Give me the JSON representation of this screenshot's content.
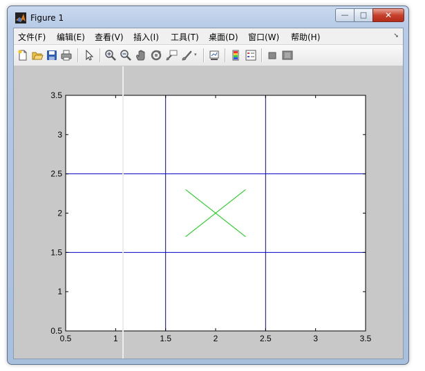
{
  "window": {
    "title": "Figure 1",
    "close_label": "✕",
    "min_label": "—",
    "max_label": "□"
  },
  "menu": {
    "items": [
      "文件(F)",
      "编辑(E)",
      "查看(V)",
      "插入(I)",
      "工具(T)",
      "桌面(D)",
      "窗口(W)",
      "帮助(H)"
    ],
    "overflow": "➘"
  },
  "toolbar": {
    "icons": [
      "new-figure-icon",
      "open-file-icon",
      "save-icon",
      "print-icon",
      "select-arrow-icon",
      "zoom-in-icon",
      "zoom-out-icon",
      "pan-hand-icon",
      "rotate-3d-icon",
      "data-cursor-icon",
      "brush-icon",
      "link-plot-icon",
      "colorbar-icon",
      "legend-icon",
      "hide-plot-tools-icon",
      "show-plot-tools-icon"
    ]
  },
  "chart_data": {
    "type": "line",
    "xlim": [
      0.5,
      3.5
    ],
    "ylim": [
      0.5,
      3.5
    ],
    "xticks": [
      "0.5",
      "1",
      "1.5",
      "2",
      "2.5",
      "3",
      "3.5"
    ],
    "yticks": [
      "0.5",
      "1",
      "1.5",
      "2",
      "2.5",
      "3",
      "3.5"
    ],
    "grid": false,
    "series": [
      {
        "color": "#0000c8",
        "points": [
          [
            0.5,
            1.5
          ],
          [
            3.5,
            1.5
          ]
        ]
      },
      {
        "color": "#0000c8",
        "points": [
          [
            0.5,
            2.5
          ],
          [
            3.5,
            2.5
          ]
        ]
      },
      {
        "color": "#0000c8",
        "points": [
          [
            1.5,
            0.5
          ],
          [
            1.5,
            3.5
          ]
        ]
      },
      {
        "color": "#0000c8",
        "points": [
          [
            2.5,
            0.5
          ],
          [
            2.5,
            3.5
          ]
        ]
      },
      {
        "color": "#00d000",
        "points": [
          [
            1.7,
            1.7
          ],
          [
            2.3,
            2.3
          ]
        ]
      },
      {
        "color": "#00d000",
        "points": [
          [
            1.7,
            2.3
          ],
          [
            2.3,
            1.7
          ]
        ]
      }
    ]
  }
}
